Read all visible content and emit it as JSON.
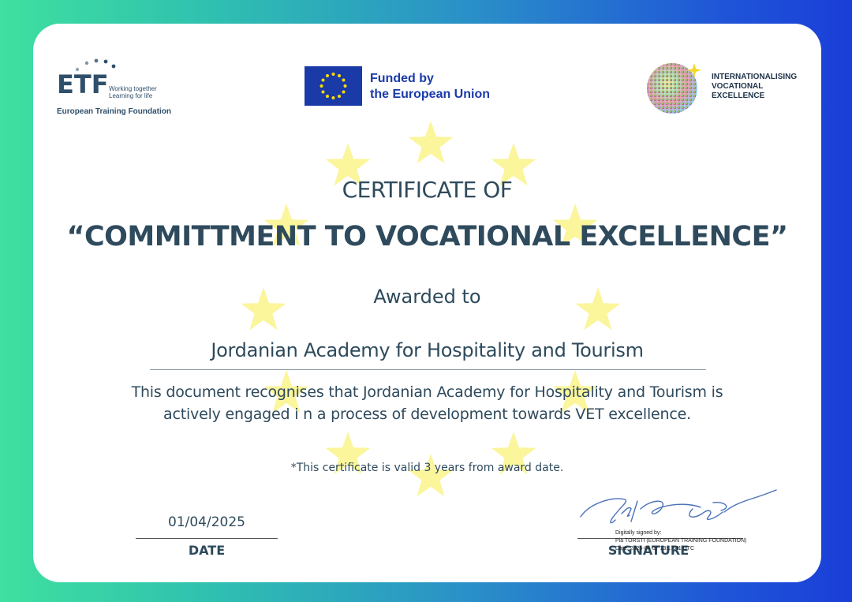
{
  "logos": {
    "etf": {
      "letters": "ETF",
      "tagline_1": "Working together",
      "tagline_2": "Learning for life",
      "name": "European Training Foundation"
    },
    "eu": {
      "line_1": "Funded by",
      "line_2": "the European Union"
    },
    "ive": {
      "line_1": "INTERNATIONALISING",
      "line_2": "VOCATIONAL",
      "line_3": "EXCELLENCE"
    }
  },
  "certificate": {
    "title_line_1": "CERTIFICATE OF",
    "title_line_2": "“COMMITTMENT TO VOCATIONAL EXCELLENCE”",
    "awarded_to": "Awarded to",
    "awardee": "Jordanian Academy for Hospitality and Tourism",
    "body_line_1": "This document recognises that Jordanian Academy for Hospitality and Tourism is",
    "body_line_2": "actively engaged i n a process of development towards VET excellence.",
    "validity_note": "*This certificate is valid 3 years from award date."
  },
  "date": {
    "value": "01/04/2025",
    "label": "DATE"
  },
  "signature": {
    "label": "SIGNATURE",
    "digital_line_1": "Digitally signed by:",
    "digital_line_2": "Pia TORSTI (EUROPEAN TRAINING FOUNDATION)",
    "digital_line_3": "Date: 2025-04-07 13:17:41 UTC"
  },
  "colors": {
    "text": "#2e4a5c",
    "eu_blue": "#1a3aa8",
    "star_yellow": "#fbf59c"
  }
}
